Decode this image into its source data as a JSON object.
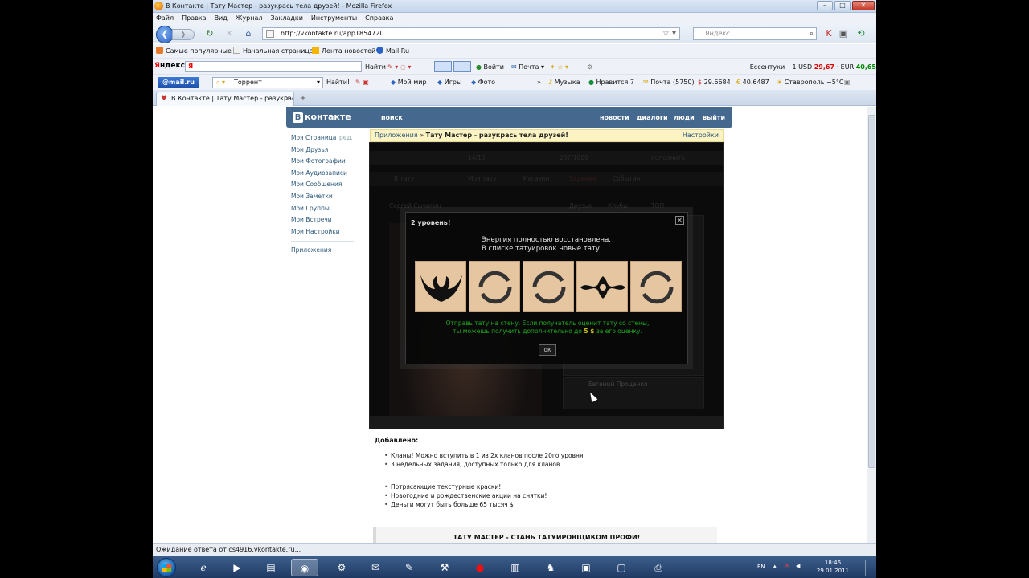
{
  "window": {
    "title": "В Контакте | Тату Мастер - разукрась тела друзей! - Mozilla Firefox",
    "min": "–",
    "max": "□",
    "close": "✕"
  },
  "menu": [
    "Файл",
    "Правка",
    "Вид",
    "Журнал",
    "Закладки",
    "Инструменты",
    "Справка"
  ],
  "nav": {
    "url": "http://vkontakte.ru/app1854720",
    "search_placeholder": "Яндекс",
    "back_glyph": "❮",
    "forward_glyph": "❯",
    "reload_glyph": "↻",
    "stop_glyph": "✕",
    "home_glyph": "⌂"
  },
  "bookmarks": [
    "Самые популярные",
    "Начальная страница",
    "Лента новостей",
    "Mail.Ru"
  ],
  "yandex": {
    "logo_y": "Я",
    "logo_rest": "ндекс",
    "input_value": "Я",
    "find": "Найти",
    "login": "Войти",
    "mail": "Почта",
    "weather_label": "Ессентуки",
    "weather_temp": "−1",
    "usd_label": "USD",
    "usd": "29,67",
    "eur_label": "EUR",
    "eur": "40,65"
  },
  "mailru": {
    "logo": "@mail.ru",
    "input_value": "Торрент",
    "find": "Найти!",
    "items": [
      "Мой мир",
      "Игры",
      "Фото",
      "Музыка",
      "Нравится 7",
      "Почта (5750)",
      "29.6684",
      "40.6487",
      "Ставрополь −5°C"
    ]
  },
  "tab": {
    "label": "В Контакте | Тату Мастер - разукрас...",
    "close": "✕",
    "new": "+"
  },
  "vk": {
    "logo_b": "B",
    "logo": "контакте",
    "search": "поиск",
    "nav": [
      "новости",
      "диалоги",
      "люди",
      "выйти"
    ],
    "edit": "ред.",
    "menu": [
      "Моя Страница",
      "Мои Друзья",
      "Мои Фотографии",
      "Мои Аудиозаписи",
      "Мои Сообщения",
      "Мои Заметки",
      "Мои Группы",
      "Мои Встречи",
      "Мои Настройки"
    ],
    "apps": "Приложения"
  },
  "breadcrumb": {
    "apps": "Приложения",
    "sep": " » ",
    "current": "Тату Мастер - разукрась тела друзей!",
    "settings": "Настройки"
  },
  "dialog": {
    "title": "2 уровень!",
    "close": "✕",
    "line1": "Энергия полностью восстановлена.",
    "line2": "В списке татуировок новые тату",
    "hint1": "Отправь тату на стену. Если получатель оценит тату со стены,",
    "hint2_pre": "ты можешь получить дополнительно до",
    "hint2_amount": "5 $",
    "hint2_post": "за его оценку.",
    "ok": "ок"
  },
  "app_background": {
    "bg1": "14/15",
    "bg2": "287/1000",
    "bg3": "пополнить",
    "bg4": "В тату",
    "bg5": "Моя тату",
    "bg6": "Магазин",
    "bg7": "Задания",
    "bg8": "События",
    "bg9": "Сергей Сычигин",
    "bg10": "Друзья",
    "bg11": "Клубы",
    "bg12": "ТОП",
    "bg13": "Евгений Проценко"
  },
  "content": {
    "added_title": "Добавлено:",
    "news1": [
      "Кланы! Можно вступить в 1 из 2х кланов после 20го уровня",
      "3 недельных задания, доступных только для кланов"
    ],
    "news2": [
      "Потрясающие текстурные краски!",
      "Новогодние и рождественские акции на снятки!",
      "Деньги могут быть больше 65 тысяч $"
    ],
    "promo": "ТАТУ МАСТЕР - СТАНЬ ТАТУИРОВЩИКОМ ПРОФИ!"
  },
  "status": "Ожидание ответа от cs4916.vkontakte.ru...",
  "taskbar": {
    "lang": "EN",
    "time": "18:46",
    "date": "29.01.2011"
  },
  "colors": {
    "vk_blue": "#45688e",
    "tattoo_bg": "#e6c6a0",
    "hint_green": "#1fa81f"
  }
}
